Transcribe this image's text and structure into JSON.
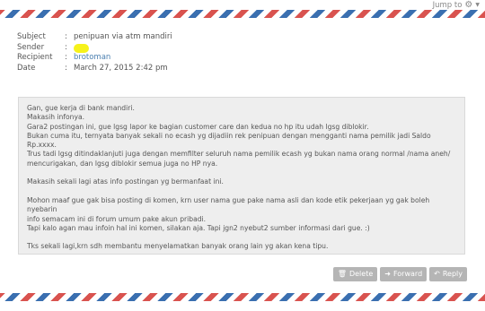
{
  "toolbar": {
    "jump_label": "Jump to",
    "gear_icon": "gear-icon"
  },
  "message": {
    "subject_label": "Subject",
    "subject": "penipuan via atm mandiri",
    "sender_label": "Sender",
    "sender": "",
    "recipient_label": "Recipient",
    "recipient": "brotoman",
    "date_label": "Date",
    "date": "March 27, 2015 2:42 pm",
    "colon": ":",
    "body": {
      "p1": "Gan, gue kerja di bank mandiri.\nMakasih infonya.\nGara2 postingan ini, gue lgsg lapor ke bagian customer care dan kedua no hp itu udah lgsg diblokir.\nBukan cuma itu, ternyata banyak sekali no ecash yg dijadiin rek penipuan dengan mengganti nama pemilik jadi Saldo Rp.xxxx.\nTrus tadi lgsg ditindaklanjuti juga dengan memfilter seluruh nama pemilik ecash yg bukan nama orang normal /nama aneh/\nmencurigakan, dan lgsg diblokir semua juga no HP nya.",
      "p2": "Makasih sekali lagi atas info postingan yg bermanfaat ini.",
      "p3": "Mohon maaf gue gak bisa posting di komen, krn user nama gue pake nama asli dan kode etik pekerjaan yg gak boleh nyebarin\ninfo semacam ini di forum umum pake akun pribadi.\nTapi kalo agan mau infoin hal ini komen, silakan aja. Tapi jgn2 nyebut2 sumber informasi dari gue. :)",
      "p4": "Tks sekali lagi,krn sdh membantu menyelamatkan banyak orang lain yg akan kena tipu."
    }
  },
  "actions": {
    "delete_label": "Delete",
    "forward_label": "Forward",
    "reply_label": "Reply"
  },
  "colors": {
    "airmail_red": "#d9534f",
    "airmail_blue": "#3a6fb0",
    "link": "#4a7fb0",
    "sender_highlight": "#f6f21b",
    "button_bg": "#b5b5b5"
  }
}
